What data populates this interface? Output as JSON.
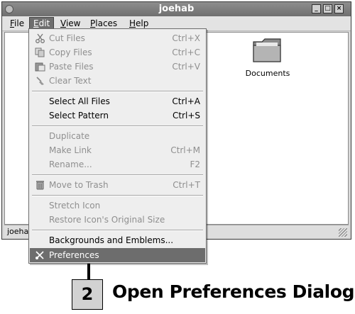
{
  "window": {
    "title": "joehab"
  },
  "menubar": {
    "items": [
      {
        "label": "File",
        "underline": "F",
        "active": false
      },
      {
        "label": "Edit",
        "underline": "E",
        "active": true
      },
      {
        "label": "View",
        "underline": "V",
        "active": false
      },
      {
        "label": "Places",
        "underline": "P",
        "active": false
      },
      {
        "label": "Help",
        "underline": "H",
        "active": false
      }
    ]
  },
  "desktop_items": [
    {
      "label": "Documents",
      "icon": "folder-icon"
    }
  ],
  "statusbar": {
    "text": "joehab"
  },
  "edit_menu": {
    "items": [
      {
        "label": "Cut Files",
        "shortcut": "Ctrl+X",
        "enabled": false,
        "icon": "scissors-icon"
      },
      {
        "label": "Copy Files",
        "shortcut": "Ctrl+C",
        "enabled": false,
        "icon": "copy-icon"
      },
      {
        "label": "Paste Files",
        "shortcut": "Ctrl+V",
        "enabled": false,
        "icon": "paste-icon"
      },
      {
        "label": "Clear Text",
        "shortcut": "",
        "enabled": false,
        "icon": "broom-icon"
      },
      {
        "label": "Select All Files",
        "shortcut": "Ctrl+A",
        "enabled": true,
        "icon": ""
      },
      {
        "label": "Select Pattern",
        "shortcut": "Ctrl+S",
        "enabled": true,
        "icon": ""
      },
      {
        "label": "Duplicate",
        "shortcut": "",
        "enabled": false,
        "icon": ""
      },
      {
        "label": "Make Link",
        "shortcut": "Ctrl+M",
        "enabled": false,
        "icon": ""
      },
      {
        "label": "Rename...",
        "shortcut": "F2",
        "enabled": false,
        "icon": ""
      },
      {
        "label": "Move to Trash",
        "shortcut": "Ctrl+T",
        "enabled": false,
        "icon": "trash-icon"
      },
      {
        "label": "Stretch Icon",
        "shortcut": "",
        "enabled": false,
        "icon": ""
      },
      {
        "label": "Restore Icon's Original Size",
        "shortcut": "",
        "enabled": false,
        "icon": ""
      },
      {
        "label": "Backgrounds and Emblems...",
        "shortcut": "",
        "enabled": true,
        "icon": ""
      },
      {
        "label": "Preferences",
        "shortcut": "",
        "enabled": true,
        "highlighted": true,
        "icon": "preferences-icon"
      }
    ]
  },
  "callout": {
    "step": "2",
    "label": "Open Preferences Dialog"
  },
  "colors": {
    "titlebar": "#7d7d7d",
    "highlight": "#6d6d6d",
    "step_box": "#d2d2d2"
  }
}
